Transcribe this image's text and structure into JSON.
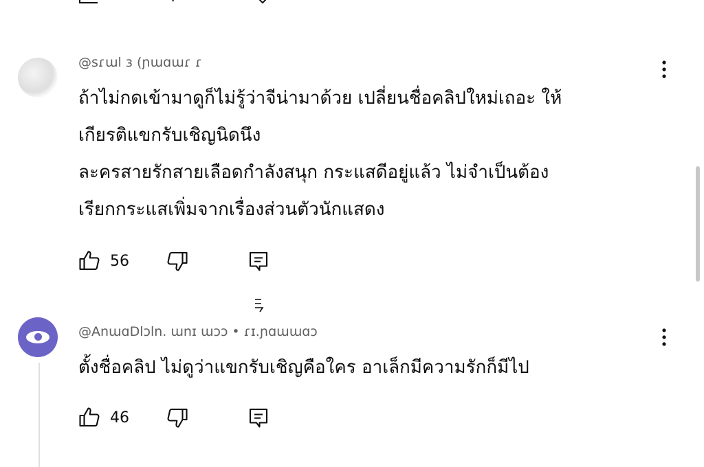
{
  "comments": [
    {
      "author_meta": "@sɾɯl                     ɜ (ɲɯɑɯɾ ɾ",
      "lines": [
        "ถ้าไม่กดเข้ามาดูก็ไม่รู้ว่าจีน่ามาด้วย เปลี่ยนชื่อคลิปใหม่เถอะ ให้",
        "เกียรติแขกรับเชิญนิดนึง",
        "ละครสายรักสายเลือดกำลังสนุก กระแสดีอยู่แล้ว ไม่จำเป็นต้อง",
        "เรียกกระแสเพิ่มจากเรื่องส่วนตัวนักแสดง"
      ],
      "likes": "56"
    },
    {
      "author_meta": "@AnɯɑDlɔln. ɯnɪ ɯɔɔ • ɾɪ.ɲɑɯɯɑɔ",
      "lines": [
        "ตั้งชื่อคลิป ไม่ดูว่าแขกรับเชิญคือใคร อาเล็กมีความรักก็มีไป"
      ],
      "likes": "46"
    }
  ],
  "icons": {
    "like": "thumbs-up-outline",
    "dislike": "thumbs-down-outline",
    "reply": "reply-comment-outline",
    "more": "vertical-ellipsis"
  },
  "colors": {
    "text": "#0f0f0f",
    "meta": "#606060",
    "avatar_2": "#6c63c7",
    "scrollbar": "#c8c8c8"
  }
}
